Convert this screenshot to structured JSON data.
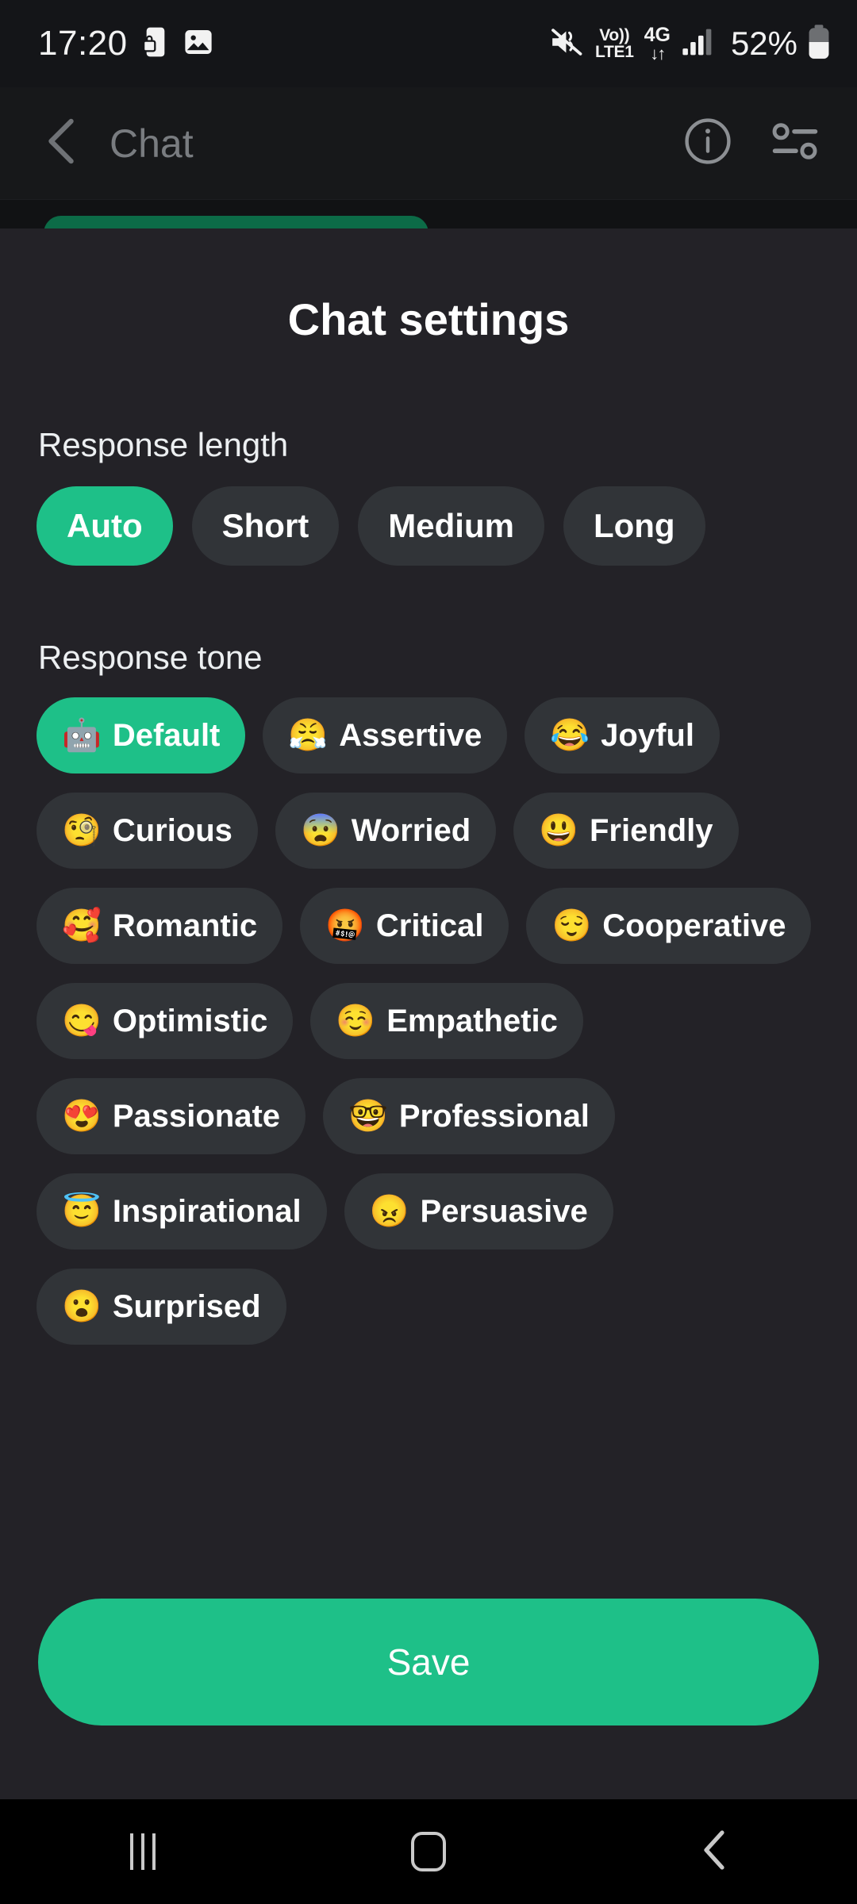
{
  "statusbar": {
    "time": "17:20",
    "icons_left": [
      "phone-lock-icon",
      "image-icon"
    ],
    "mute_icon": "mute-icon",
    "volte_line1": "Vo))",
    "volte_line2": "LTE1",
    "network_type": "4G",
    "network_arrows": "↓↑",
    "signal_icon": "signal-bars-icon",
    "battery_percent": "52%",
    "battery_icon": "battery-icon"
  },
  "appbar": {
    "back_icon": "chevron-left-icon",
    "title": "Chat",
    "info_icon": "info-circle-icon",
    "settings_icon": "sliders-icon"
  },
  "sheet": {
    "title": "Chat settings",
    "response_length": {
      "label": "Response length",
      "selected": "Auto",
      "options": [
        {
          "label": "Auto",
          "selected": true
        },
        {
          "label": "Short",
          "selected": false
        },
        {
          "label": "Medium",
          "selected": false
        },
        {
          "label": "Long",
          "selected": false
        }
      ]
    },
    "response_tone": {
      "label": "Response tone",
      "selected": "Default",
      "options": [
        {
          "emoji": "🤖",
          "label": "Default",
          "selected": true
        },
        {
          "emoji": "😤",
          "label": "Assertive",
          "selected": false
        },
        {
          "emoji": "😂",
          "label": "Joyful",
          "selected": false
        },
        {
          "emoji": "🧐",
          "label": "Curious",
          "selected": false
        },
        {
          "emoji": "😨",
          "label": "Worried",
          "selected": false
        },
        {
          "emoji": "😃",
          "label": "Friendly",
          "selected": false
        },
        {
          "emoji": "🥰",
          "label": "Romantic",
          "selected": false
        },
        {
          "emoji": "🤬",
          "label": "Critical",
          "selected": false
        },
        {
          "emoji": "😌",
          "label": "Cooperative",
          "selected": false
        },
        {
          "emoji": "😋",
          "label": "Optimistic",
          "selected": false
        },
        {
          "emoji": "☺️",
          "label": "Empathetic",
          "selected": false
        },
        {
          "emoji": "😍",
          "label": "Passionate",
          "selected": false
        },
        {
          "emoji": "🤓",
          "label": "Professional",
          "selected": false
        },
        {
          "emoji": "😇",
          "label": "Inspirational",
          "selected": false
        },
        {
          "emoji": "😠",
          "label": "Persuasive",
          "selected": false
        },
        {
          "emoji": "😮",
          "label": "Surprised",
          "selected": false
        }
      ]
    },
    "save_label": "Save"
  },
  "navbar": {
    "recents_icon": "recents-icon",
    "home_icon": "home-icon",
    "back_icon": "back-icon"
  },
  "colors": {
    "accent": "#1ec088",
    "sheet_bg": "#232227",
    "chip_bg": "#313438",
    "statusbar_bg": "#141518",
    "navbar_bg": "#000000"
  }
}
